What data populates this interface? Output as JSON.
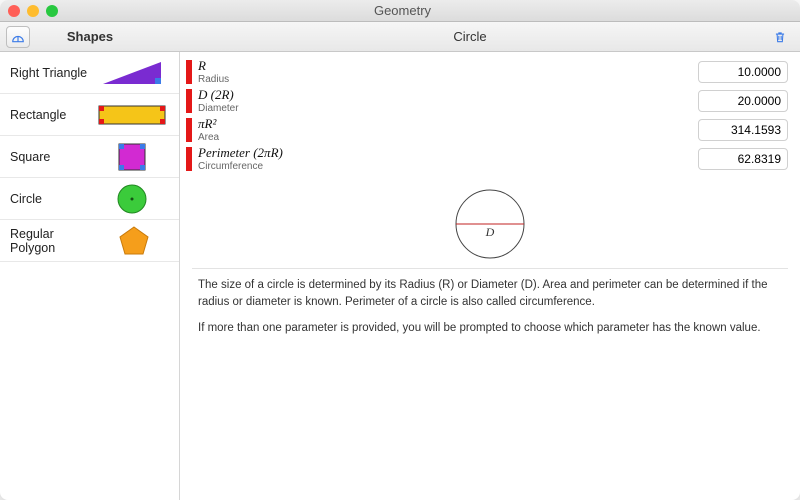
{
  "window": {
    "title": "Geometry"
  },
  "sidebar": {
    "title": "Shapes",
    "items": [
      {
        "label": "Right Triangle"
      },
      {
        "label": "Rectangle"
      },
      {
        "label": "Square"
      },
      {
        "label": "Circle"
      },
      {
        "label": "Regular Polygon"
      }
    ]
  },
  "detail": {
    "title": "Circle",
    "rows": [
      {
        "formula": "R",
        "caption": "Radius",
        "value": "10.0000"
      },
      {
        "formula": "D (2R)",
        "caption": "Diameter",
        "value": "20.0000"
      },
      {
        "formula": "πR²",
        "caption": "Area",
        "value": "314.1593"
      },
      {
        "formula": "Perimeter (2πR)",
        "caption": "Circumference",
        "value": "62.8319"
      }
    ],
    "diagram_label": "D",
    "description": {
      "p1": "The size of a circle is determined by its Radius (R) or Diameter (D). Area and perimeter can be determined if the radius or diameter is known. Perimeter of a circle is also called circumference.",
      "p2": "If more than one parameter is provided, you will be prompted to choose which parameter has the known value."
    }
  },
  "icons": {
    "measure": "protractor-icon",
    "trash": "trash-icon"
  },
  "colors": {
    "accent_blue": "#3b7be8",
    "marker_red": "#e41818",
    "triangle": "#7a2bd1",
    "rectangle": "#f5c518",
    "square": "#d22ad2",
    "circle": "#3bcb3b",
    "polygon": "#f59e1b"
  }
}
